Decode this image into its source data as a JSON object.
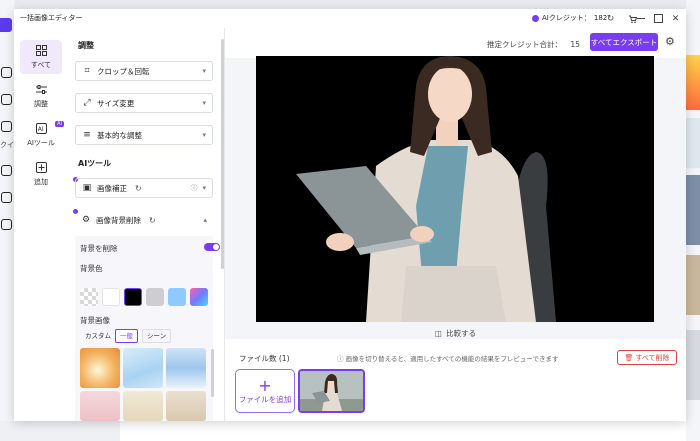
{
  "window": {
    "title": "一括画像エディター",
    "credit_label": "AIクレジット：",
    "credit_value": "182"
  },
  "nav": {
    "items": [
      {
        "label": "すべて",
        "icon": "grid-icon"
      },
      {
        "label": "調整",
        "icon": "sliders-icon"
      },
      {
        "label": "AIツール",
        "icon": "ai-icon"
      },
      {
        "label": "追加",
        "icon": "plus-square-icon"
      }
    ]
  },
  "panel": {
    "adjust_title": "調整",
    "crop_label": "クロップ＆回転",
    "resize_label": "サイズ変更",
    "basic_label": "基本的な調整",
    "ai_title": "AIツール",
    "enhance_label": "画像補正",
    "bgremove_label": "画像背景削除",
    "remove_bg_label": "背景を削除",
    "bg_color_label": "背景色",
    "bg_image_label": "背景画像",
    "bg_tabs": [
      "カスタム",
      "一般",
      "シーン"
    ],
    "swatch_colors": [
      "#d9d9d9",
      "#ffffff",
      "#000000",
      "#cdcdd2",
      "#8ec9ff"
    ]
  },
  "toolbar": {
    "cost_label": "推定クレジット合計：",
    "cost_value": "15",
    "export_label": "すべてエクスポート"
  },
  "preview": {
    "compare_label": "比較する"
  },
  "files": {
    "count_label": "ファイル数 (1)",
    "hint": "画像を切り替えると、適用したすべての機能の結果をプレビューできます",
    "delete_all_label": "すべて削除",
    "add_file_label": "ファイルを追加"
  },
  "background_app": {
    "left_fragment": "クイ"
  }
}
